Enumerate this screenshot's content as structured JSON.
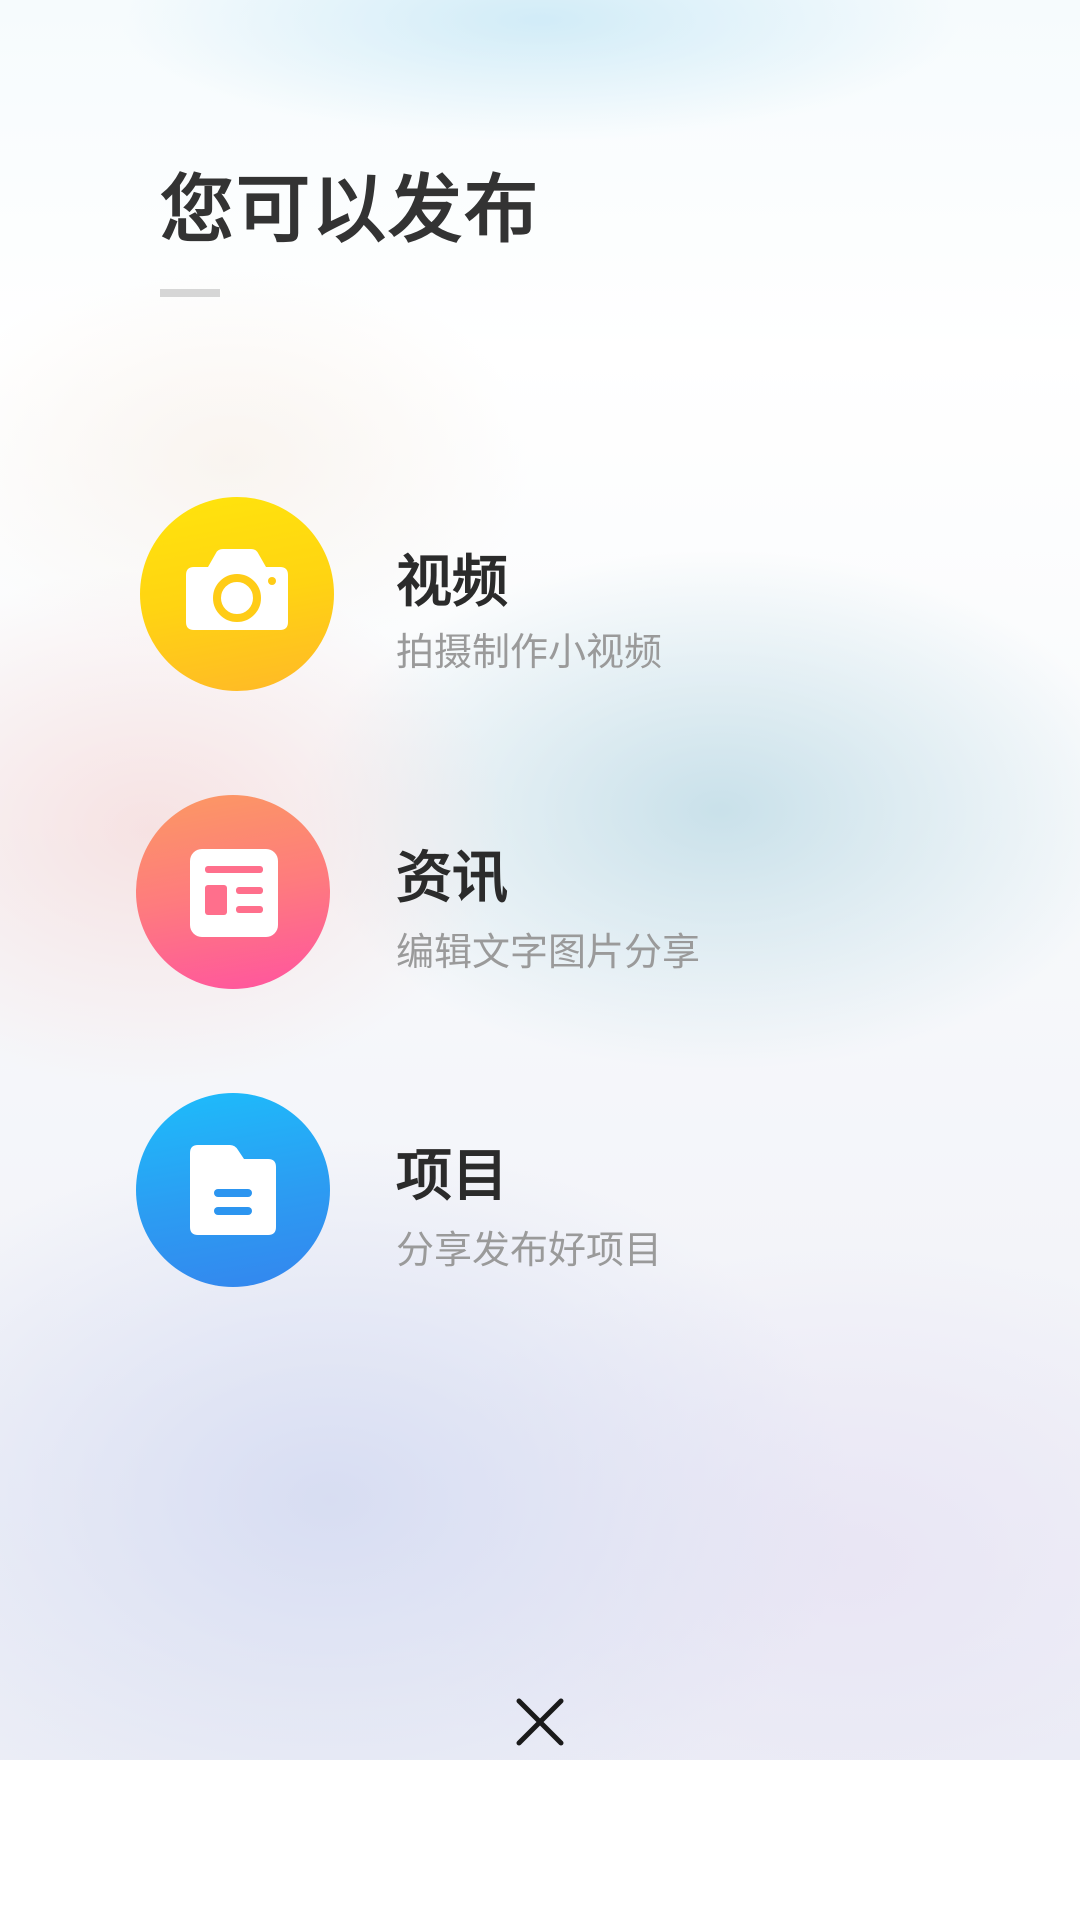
{
  "header": {
    "title": "您可以发布"
  },
  "options": [
    {
      "title": "视频",
      "subtitle": "拍摄制作小视频",
      "icon": "camera-icon",
      "color_start": "#ffe40c",
      "color_end": "#ffb828"
    },
    {
      "title": "资讯",
      "subtitle": "编辑文字图片分享",
      "icon": "news-article-icon",
      "color_start": "#fb9962",
      "color_end": "#ff53a0"
    },
    {
      "title": "项目",
      "subtitle": "分享发布好项目",
      "icon": "document-icon",
      "color_start": "#1dbdfb",
      "color_end": "#3485ee"
    }
  ],
  "footer": {
    "close_icon": "close-icon"
  }
}
